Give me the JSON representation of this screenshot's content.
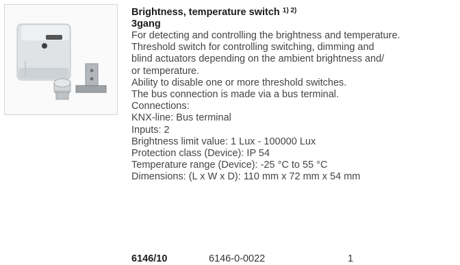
{
  "product": {
    "title": "Brightness, temperature switch",
    "footnotes": "1) 2)",
    "subtitle": "3gang",
    "lines": [
      "For detecting and controlling the brightness and temperature.",
      "Threshold switch for controlling switching, dimming and",
      "blind actuators depending on the ambient brightness and/",
      "or temperature.",
      "Ability to disable one or more threshold switches.",
      "The bus connection is made via a bus terminal.",
      "Connections:",
      "KNX-line: Bus terminal",
      "Inputs: 2",
      "Brightness limit value: 1 Lux - 100000 Lux",
      "Protection class (Device): IP 54",
      "Temperature range (Device): -25 °C to 55 °C",
      "Dimensions: (L x W x D): 110 mm x 72 mm x 54 mm"
    ]
  },
  "order": {
    "number": "6146/10",
    "code": "6146-0-0022",
    "quantity": "1"
  }
}
